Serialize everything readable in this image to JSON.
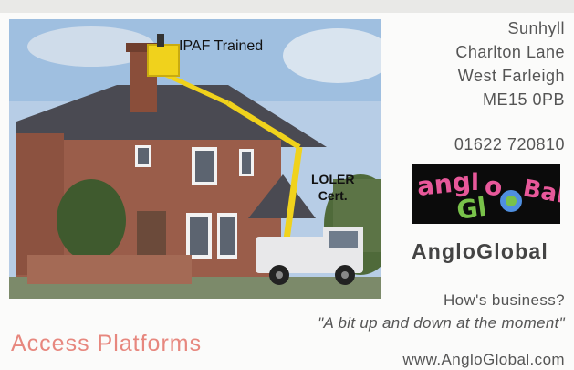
{
  "address": {
    "line1": "Sunhyll",
    "line2": "Charlton Lane",
    "line3": "West Farleigh",
    "line4": "ME15 0PB"
  },
  "phone": "01622 720810",
  "logo": {
    "text": "angloGlobal"
  },
  "brand_name": "AngloGlobal",
  "tagline_question": "How's business?",
  "tagline_quote": "\"A bit up and down at the moment\"",
  "service": "Access Platforms",
  "website": "www.AngloGlobal.com",
  "photo": {
    "label_ipaf": "IPAF Trained",
    "label_loler_1": "LOLER",
    "label_loler_2": "Cert."
  },
  "colors": {
    "accent": "#e7877e",
    "text": "#555555",
    "logo_pink": "#e8589a",
    "logo_green": "#79c24a",
    "logo_blue": "#4f8fe0",
    "boom_yellow": "#f0d21c"
  }
}
